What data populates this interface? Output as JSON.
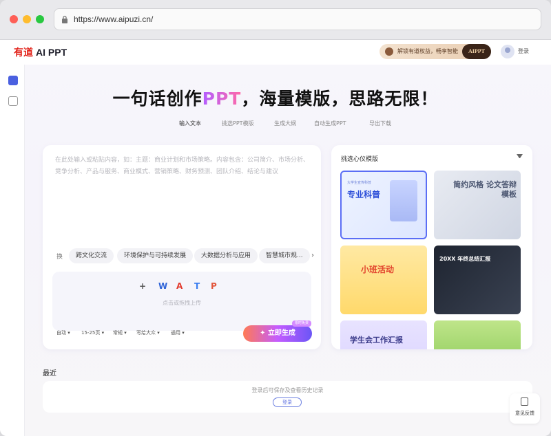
{
  "browser": {
    "url": "https://www.aipuzi.cn/"
  },
  "header": {
    "logo_brand": "有道",
    "logo_product": "AI PPT",
    "promo_text": "解锁有道权益，畅享智能",
    "promo_badge": "AIPPT",
    "login": "登录"
  },
  "sidebar": {
    "items": [
      {
        "icon": "home-icon"
      },
      {
        "icon": "document-icon"
      }
    ]
  },
  "hero": {
    "title_a": "一句话创作",
    "title_b": "PPT",
    "title_c": "，海量模版，思路无限！"
  },
  "steps": [
    "输入文本",
    "挑选PPT模版",
    "生成大纲",
    "自动生成PPT",
    "导出下载"
  ],
  "input": {
    "placeholder": "在此处输入或粘贴内容，如：主题：商业计划和市场策略。内容包含：公司简介、市场分析、竞争分析、产品与服务、商业模式、营销策略、财务预测、团队介绍、结论与建议",
    "tag_lead": "换",
    "tags": [
      "跨文化交流",
      "环境保护与可持续发展",
      "大数据分析与应用",
      "智慧城市规..."
    ],
    "upload_icons": [
      "+",
      "W",
      "A",
      "T",
      "P"
    ],
    "upload_text": "点击或拖拽上传",
    "options": [
      "自动",
      "15-25页",
      "常规",
      "写给大众",
      "通用"
    ],
    "generate_label": "立即生成",
    "generate_tag": "限时免费"
  },
  "templates": {
    "title": "挑选心仪模版",
    "items": [
      {
        "name": "专业科普",
        "subtitle": "大学生宣传科普"
      },
      {
        "name": "简约风格 论文答辩模板",
        "subtitle": ""
      },
      {
        "name": "小班活动",
        "subtitle": ""
      },
      {
        "name": "20XX 年终总结汇报",
        "subtitle": ""
      },
      {
        "name": "学生会工作汇报",
        "subtitle": ""
      },
      {
        "name": "",
        "subtitle": ""
      }
    ]
  },
  "recent": {
    "label": "最近",
    "hint": "登录后可保存及查看历史记录",
    "login_button": "登录"
  },
  "feedback": {
    "label": "意见反馈"
  },
  "colors": {
    "accent": "#5b6ef5",
    "brand_red": "#e2231a"
  }
}
